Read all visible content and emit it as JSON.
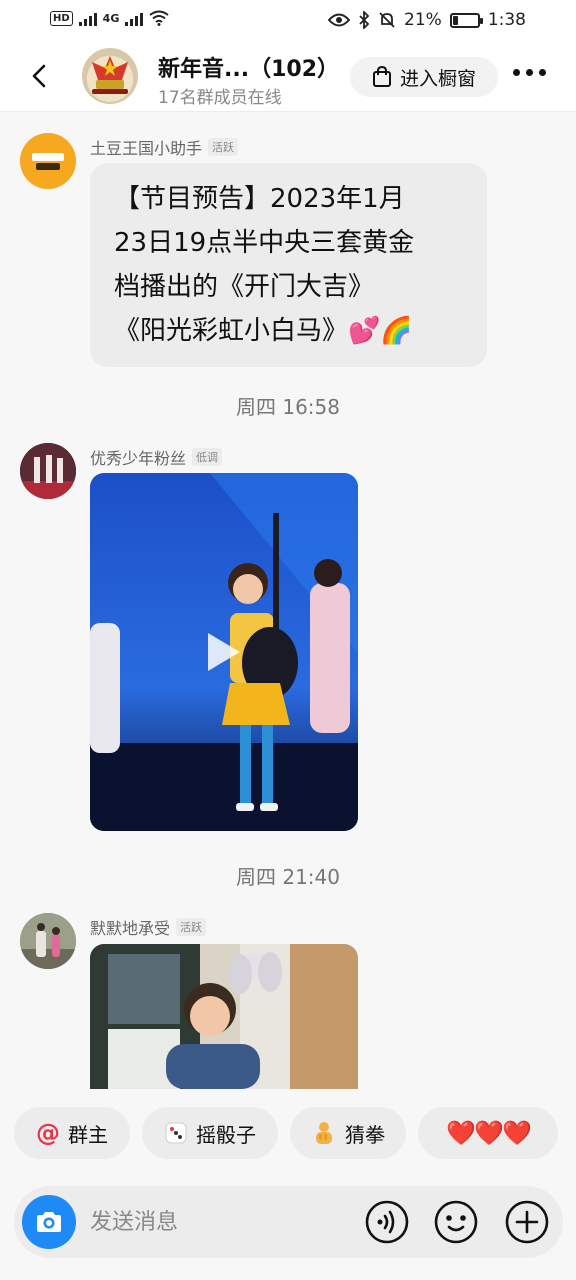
{
  "status_bar": {
    "left_text": "HD",
    "network": "4G",
    "battery": "21%",
    "battery_level": 0.21,
    "time": "1:38"
  },
  "header": {
    "group_name": "新年音...（102）",
    "online_text": "17名群成员在线",
    "shop_button_label": "进入橱窗"
  },
  "messages": [
    {
      "sender": "土豆王国小助手",
      "tag": "活跃",
      "text_lines": [
        "【节目预告】2023年1月",
        "23日19点半中央三套黄金",
        "档播出的《开门大吉》",
        "《阳光彩虹小白马》💕🌈"
      ]
    },
    {
      "timestamp": "周四 16:58"
    },
    {
      "sender": "优秀少年粉丝",
      "tag": "低调",
      "media": "video"
    },
    {
      "timestamp": "周四 21:40"
    },
    {
      "sender": "默默地承受",
      "tag": "活跃",
      "media": "image"
    }
  ],
  "quick_replies": [
    {
      "icon": "at-icon",
      "label": "群主"
    },
    {
      "icon": "dice-icon",
      "label": "摇骰子"
    },
    {
      "icon": "rock-paper-scissors-icon",
      "label": "猜拳"
    },
    {
      "icon": "hearts-icon",
      "label": "❤️❤️❤️"
    }
  ],
  "input": {
    "placeholder": "发送消息"
  },
  "colors": {
    "accent_blue": "#1d8af5",
    "bubble_bg": "#ececec",
    "background": "#f7f7f7"
  }
}
